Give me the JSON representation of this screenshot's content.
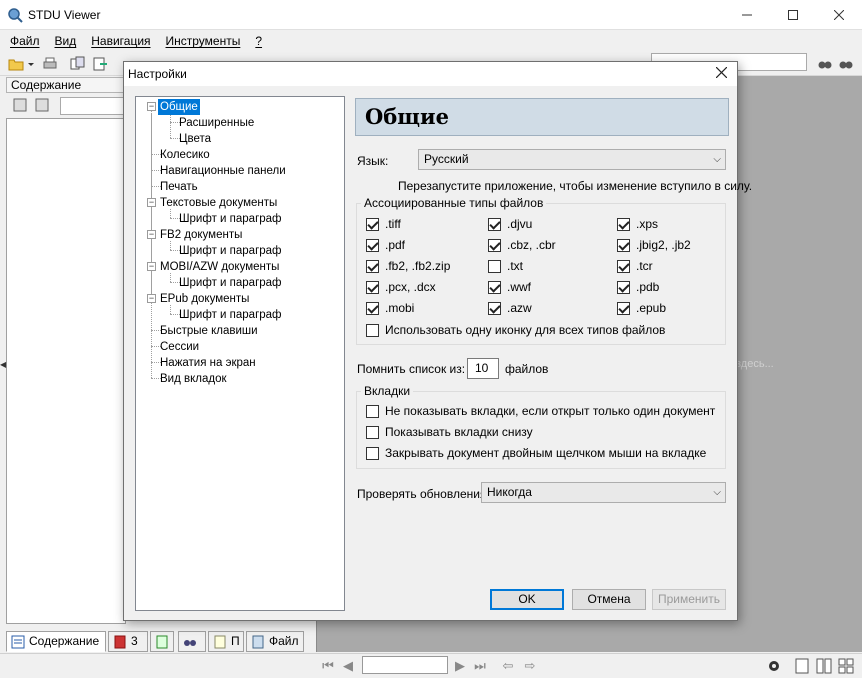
{
  "app": {
    "title": "STDU Viewer"
  },
  "menu": [
    "Файл",
    "Вид",
    "Навигация",
    "Инструменты",
    "?"
  ],
  "left_panel": {
    "header": "Содержание",
    "bottom_tabs": [
      "Содержание",
      "3",
      "П",
      "Файл"
    ]
  },
  "viewer": {
    "hint": "здесь..."
  },
  "dialog": {
    "title": "Настройки",
    "tree": [
      {
        "label": "Общие",
        "level": 0,
        "selected": true
      },
      {
        "label": "Расширенные",
        "level": 1
      },
      {
        "label": "Цвета",
        "level": 1
      },
      {
        "label": "Колесико",
        "level": 0
      },
      {
        "label": "Навигационные панели",
        "level": 0
      },
      {
        "label": "Печать",
        "level": 0
      },
      {
        "label": "Текстовые документы",
        "level": 0
      },
      {
        "label": "Шрифт и параграф",
        "level": 1
      },
      {
        "label": "FB2 документы",
        "level": 0
      },
      {
        "label": "Шрифт и параграф",
        "level": 1
      },
      {
        "label": "MOBI/AZW документы",
        "level": 0
      },
      {
        "label": "Шрифт и параграф",
        "level": 1
      },
      {
        "label": "EPub документы",
        "level": 0
      },
      {
        "label": "Шрифт и параграф",
        "level": 1
      },
      {
        "label": "Быстрые клавиши",
        "level": 0
      },
      {
        "label": "Сессии",
        "level": 0
      },
      {
        "label": "Нажатия на экран",
        "level": 0
      },
      {
        "label": "Вид вкладок",
        "level": 0
      }
    ],
    "section_title": "Общие",
    "language": {
      "label": "Язык:",
      "value": "Русский"
    },
    "restart_note": "Перезапустите приложение, чтобы изменение вступило в силу.",
    "file_types": {
      "title": "Ассоциированные типы файлов",
      "items": [
        {
          "label": ".tiff",
          "checked": true
        },
        {
          "label": ".djvu",
          "checked": true
        },
        {
          "label": ".xps",
          "checked": true
        },
        {
          "label": ".pdf",
          "checked": true
        },
        {
          "label": ".cbz, .cbr",
          "checked": true
        },
        {
          "label": ".jbig2, .jb2",
          "checked": true
        },
        {
          "label": ".fb2, .fb2.zip",
          "checked": true
        },
        {
          "label": ".txt",
          "checked": false
        },
        {
          "label": ".tcr",
          "checked": true
        },
        {
          "label": ".pcx, .dcx",
          "checked": true
        },
        {
          "label": ".wwf",
          "checked": true
        },
        {
          "label": ".pdb",
          "checked": true
        },
        {
          "label": ".mobi",
          "checked": true
        },
        {
          "label": ".azw",
          "checked": true
        },
        {
          "label": ".epub",
          "checked": true
        }
      ],
      "single_icon": {
        "label": "Использовать одну иконку для всех типов файлов",
        "checked": false
      }
    },
    "recent": {
      "label": "Помнить список из:",
      "value": "10",
      "suffix": "файлов"
    },
    "tabs": {
      "title": "Вкладки",
      "items": [
        {
          "label": "Не показывать вкладки, если открыт только один документ",
          "checked": false
        },
        {
          "label": "Показывать вкладки снизу",
          "checked": false
        },
        {
          "label": "Закрывать документ двойным щелчком мыши на вкладке",
          "checked": false
        }
      ]
    },
    "updates": {
      "label": "Проверять обновления:",
      "value": "Никогда"
    },
    "buttons": {
      "ok": "OK",
      "cancel": "Отмена",
      "apply": "Применить"
    }
  }
}
